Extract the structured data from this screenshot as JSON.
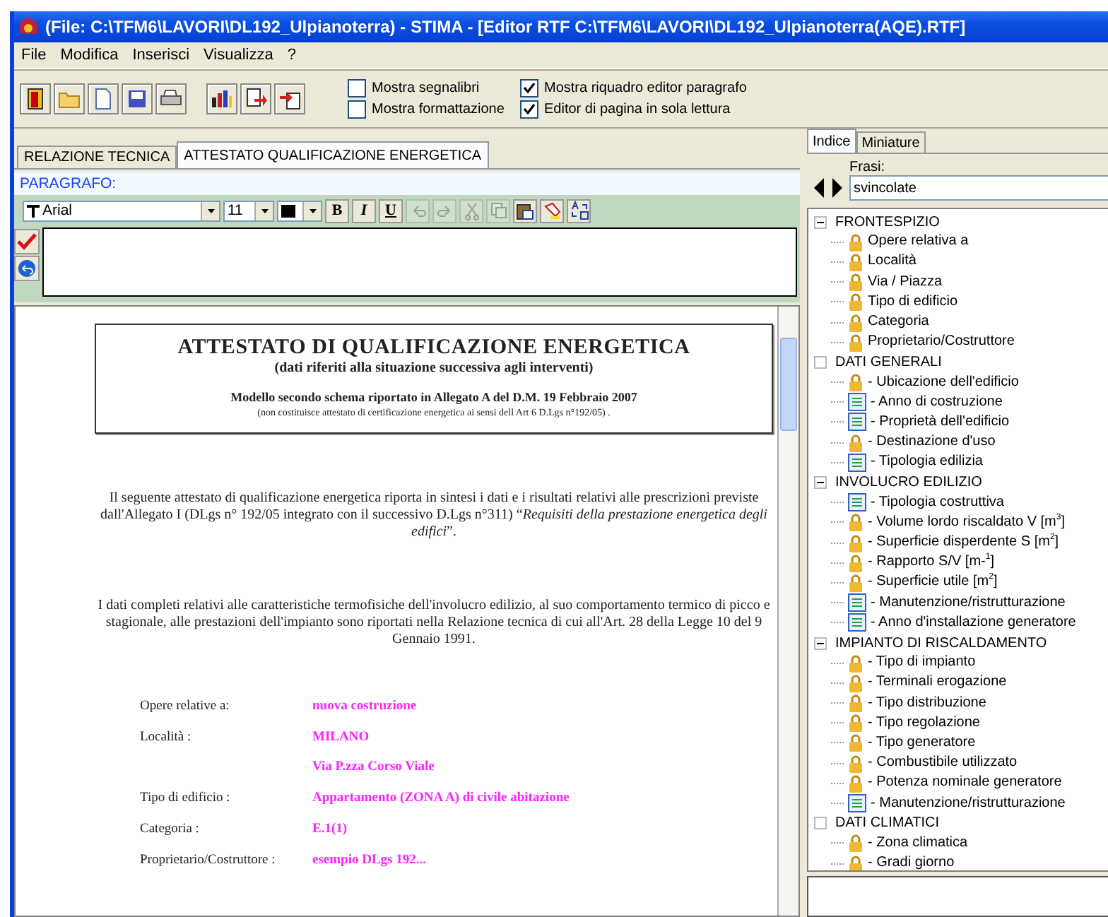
{
  "window": {
    "title": "(File: C:\\TFM6\\LAVORI\\DL192_Ulpianoterra) - STIMA - [Editor RTF C:\\TFM6\\LAVORI\\DL192_Ulpianoterra(AQE).RTF]"
  },
  "menu": [
    "File",
    "Modifica",
    "Inserisci",
    "Visualizza",
    "?"
  ],
  "toolbar": {
    "buttons": [
      {
        "kind": "exit"
      },
      {
        "kind": "open"
      },
      {
        "kind": "new"
      },
      {
        "kind": "save"
      },
      {
        "kind": "print"
      },
      {
        "kind": "chart"
      },
      {
        "kind": "export"
      },
      {
        "kind": "import"
      }
    ],
    "checkboxes": [
      {
        "label": "Mostra segnalibri",
        "checked": false
      },
      {
        "label": "Mostra formattazione",
        "checked": false
      },
      {
        "label": "Mostra riquadro editor paragrafo",
        "checked": true
      },
      {
        "label": "Editor di pagina in sola lettura",
        "checked": true
      }
    ]
  },
  "editor": {
    "tabs": [
      {
        "label": "RELAZIONE TECNICA",
        "selected": false
      },
      {
        "label": "ATTESTATO QUALIFICAZIONE ENERGETICA",
        "selected": true
      }
    ],
    "paragraph_label": "PARAGRAFO:",
    "format": {
      "font": "Arial",
      "size": "11",
      "color": "#000000",
      "style_buttons": [
        {
          "label": "B",
          "kind": "bold"
        },
        {
          "label": "I",
          "kind": "italic"
        },
        {
          "label": "U",
          "kind": "underline"
        }
      ],
      "tools": [
        {
          "kind": "undo",
          "disabled": true
        },
        {
          "kind": "redo",
          "disabled": true
        },
        {
          "kind": "cut",
          "disabled": true
        },
        {
          "kind": "copy",
          "disabled": true
        },
        {
          "kind": "paste",
          "disabled": false
        },
        {
          "kind": "highlight",
          "disabled": false
        },
        {
          "kind": "replace",
          "disabled": false
        }
      ]
    },
    "side_buttons": [
      {
        "kind": "confirm"
      },
      {
        "kind": "undo"
      }
    ]
  },
  "document": {
    "heading": {
      "title": "ATTESTATO DI QUALIFICAZIONE ENERGETICA",
      "subtitle": "(dati riferiti alla situazione successiva agli interventi)",
      "model": "Modello secondo schema riportato in Allegato A del D.M. 19 Febbraio 2007",
      "note": "(non costituisce attestato di certificazione energetica ai sensi dell Art 6 D.Lgs n°192/05) ."
    },
    "paragraphs": [
      "Il seguente attestato di qualificazione energetica riporta in sintesi i dati e i risultati relativi alle prescrizioni previste dall'Allegato I (DLgs n° 192/05 integrato con il successivo D.Lgs n°311) “*Requisiti della prestazione energetica degli edifici*”.",
      "I dati completi relativi alle caratteristiche termofisiche dell'involucro edilizio, al suo comportamento termico di picco e stagionale, alle prestazioni dell'impianto sono riportati nella Relazione tecnica di cui all'Art. 28 della Legge 10 del 9 Gennaio 1991."
    ],
    "fields": [
      {
        "label": "Opere relative a:",
        "values": [
          "nuova costruzione"
        ]
      },
      {
        "label": "Località :",
        "values": [
          "MILANO",
          "Via P.zza Corso Viale"
        ]
      },
      {
        "label": "Tipo di edificio :",
        "values": [
          "Appartamento  (ZONA A) di civile abitazione"
        ]
      },
      {
        "label": "Categoria :",
        "values": [
          "E.1(1)"
        ]
      },
      {
        "label": "Proprietario/Costruttore :",
        "values": [
          "esempio DLgs 192..."
        ]
      }
    ]
  },
  "side_panel": {
    "tabs": [
      {
        "label": "Indice",
        "selected": true
      },
      {
        "label": "Miniature",
        "selected": false
      }
    ],
    "phrases_label": "Frasi:",
    "phrases_value": "svincolate",
    "tree": [
      {
        "label": "FRONTESPIZIO",
        "expanded": true,
        "children": [
          {
            "label": "Opere relativa a",
            "kind": "lock"
          },
          {
            "label": "Località",
            "kind": "lock"
          },
          {
            "label": "Via / Piazza",
            "kind": "lock"
          },
          {
            "label": "Tipo di edificio",
            "kind": "lock"
          },
          {
            "label": "Categoria",
            "kind": "lock"
          },
          {
            "label": "Proprietario/Costruttore",
            "kind": "lock"
          }
        ]
      },
      {
        "label": "DATI GENERALI",
        "expanded": false,
        "children": [
          {
            "label": "- Ubicazione dell'edificio",
            "kind": "lock"
          },
          {
            "label": "- Anno di costruzione",
            "kind": "text"
          },
          {
            "label": "- Proprietà dell'edificio",
            "kind": "text"
          },
          {
            "label": "- Destinazione d'uso",
            "kind": "lock"
          },
          {
            "label": "- Tipologia edilizia",
            "kind": "text"
          }
        ]
      },
      {
        "label": "INVOLUCRO EDILIZIO",
        "expanded": true,
        "children": [
          {
            "label": "- Tipologia costruttiva",
            "kind": "text"
          },
          {
            "label": "- Volume lordo riscaldato V [m$^{3}$]",
            "kind": "lock"
          },
          {
            "label": "- Superficie disperdente S [m$^{2}$]",
            "kind": "lock"
          },
          {
            "label": "- Rapporto S/V [m-$^{1}$]",
            "kind": "lock"
          },
          {
            "label": "- Superficie utile [m$^{2}$]",
            "kind": "lock"
          },
          {
            "label": "- Manutenzione/ristrutturazione",
            "kind": "text"
          },
          {
            "label": "- Anno d'installazione generatore",
            "kind": "text"
          }
        ]
      },
      {
        "label": "IMPIANTO DI RISCALDAMENTO",
        "expanded": true,
        "children": [
          {
            "label": "- Tipo di impianto",
            "kind": "lock"
          },
          {
            "label": "- Terminali erogazione",
            "kind": "lock"
          },
          {
            "label": "- Tipo distribuzione",
            "kind": "lock"
          },
          {
            "label": "- Tipo regolazione",
            "kind": "lock"
          },
          {
            "label": "- Tipo generatore",
            "kind": "lock"
          },
          {
            "label": "- Combustibile utilizzato",
            "kind": "lock"
          },
          {
            "label": "- Potenza nominale generatore",
            "kind": "lock"
          },
          {
            "label": "- Manutenzione/ristrutturazione",
            "kind": "text"
          }
        ]
      },
      {
        "label": "DATI CLIMATICI",
        "expanded": false,
        "children": [
          {
            "label": "- Zona climatica",
            "kind": "lock"
          },
          {
            "label": "- Gradi giorno",
            "kind": "lock"
          }
        ]
      }
    ]
  }
}
